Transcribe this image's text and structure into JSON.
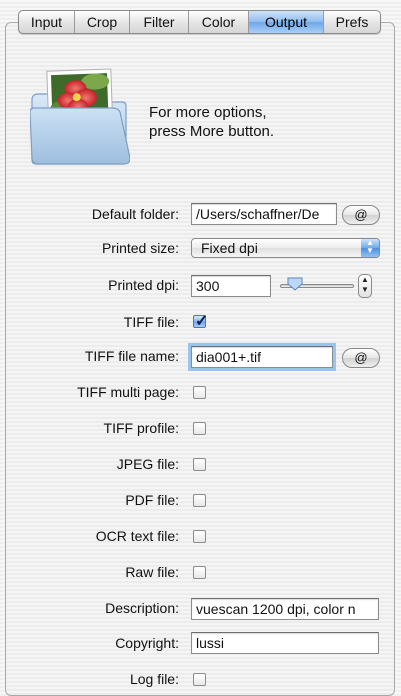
{
  "tabs": [
    {
      "label": "Input",
      "active": false
    },
    {
      "label": "Crop",
      "active": false
    },
    {
      "label": "Filter",
      "active": false
    },
    {
      "label": "Color",
      "active": false
    },
    {
      "label": "Output",
      "active": true
    },
    {
      "label": "Prefs",
      "active": false
    }
  ],
  "hint": {
    "line1": "For more options,",
    "line2": "press More button."
  },
  "at_button_label": "@",
  "fields": {
    "default_folder": {
      "label": "Default folder:",
      "value": "/Users/schaffner/De"
    },
    "printed_size": {
      "label": "Printed size:",
      "value": "Fixed dpi"
    },
    "printed_dpi": {
      "label": "Printed dpi:",
      "value": "300",
      "slider_fraction": 0.12
    },
    "tiff_file": {
      "label": "TIFF file:",
      "checked": true
    },
    "tiff_file_name": {
      "label": "TIFF file name:",
      "value": "dia001+.tif"
    },
    "tiff_multi_page": {
      "label": "TIFF multi page:",
      "checked": false
    },
    "tiff_profile": {
      "label": "TIFF profile:",
      "checked": false
    },
    "jpeg_file": {
      "label": "JPEG file:",
      "checked": false
    },
    "pdf_file": {
      "label": "PDF file:",
      "checked": false
    },
    "ocr_text_file": {
      "label": "OCR text file:",
      "checked": false
    },
    "raw_file": {
      "label": "Raw file:",
      "checked": false
    },
    "description": {
      "label": "Description:",
      "value": "vuescan 1200 dpi, color n"
    },
    "copyright": {
      "label": "Copyright:",
      "value": "lussi"
    },
    "log_file": {
      "label": "Log file:",
      "checked": false
    }
  },
  "colors": {
    "accent": "#6ea7e8",
    "panel_bg": "#efefef",
    "focus_ring": "#9cc2ee"
  },
  "icons": {
    "folder": "folder-with-flower-photo-icon",
    "popup": "up-down-arrows-icon",
    "stepper": "stepper-icon",
    "checkmark": "checkmark-icon"
  }
}
